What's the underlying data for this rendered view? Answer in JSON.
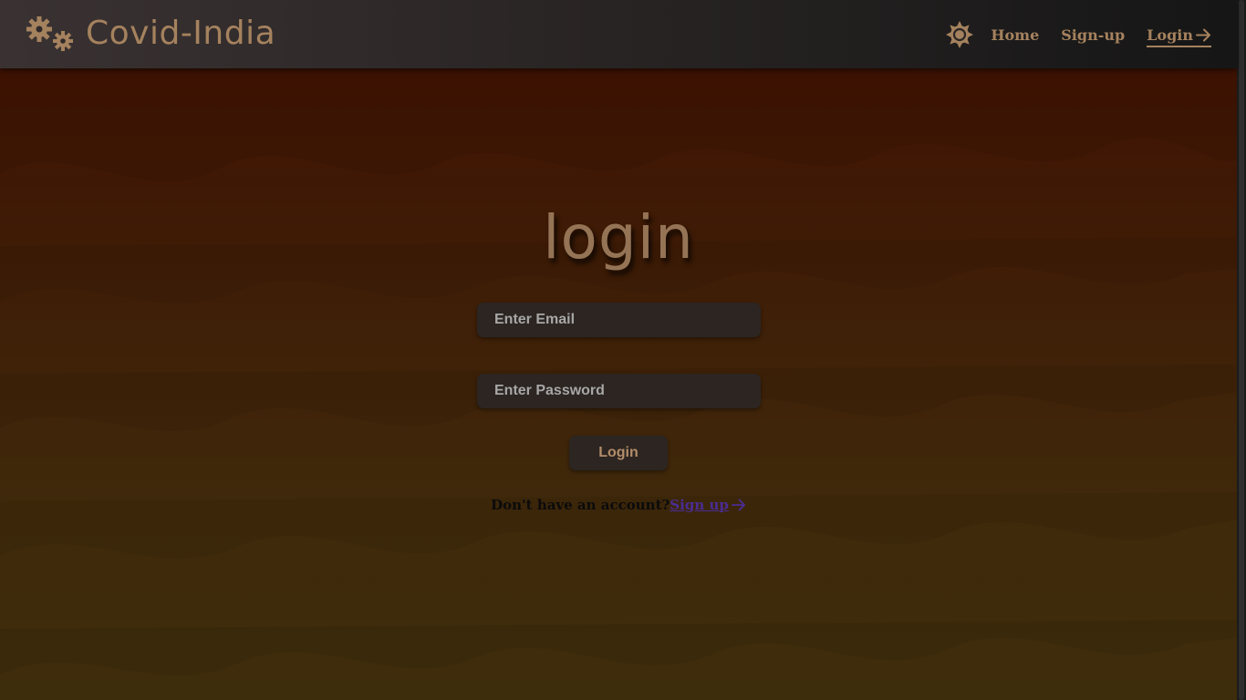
{
  "header": {
    "brand_name": "Covid-India",
    "nav": {
      "home": "Home",
      "signup": "Sign-up",
      "login": "Login"
    }
  },
  "login": {
    "title": "login",
    "email_placeholder": "Enter Email",
    "password_placeholder": "Enter Password",
    "submit_label": "Login",
    "no_account_text": "Don't have an account?",
    "signup_link_label": "Sign up"
  },
  "colors": {
    "accent": "#a5825e",
    "input_bg": "#2c2521",
    "link": "#4a2c93",
    "bg_top": "#421102",
    "bg_bottom": "#3e2d0c"
  },
  "icons": {
    "brand": "gears-icon",
    "theme_toggle": "sun-icon",
    "login_arrow": "arrow-right-icon",
    "signup_arrow": "arrow-right-icon"
  }
}
